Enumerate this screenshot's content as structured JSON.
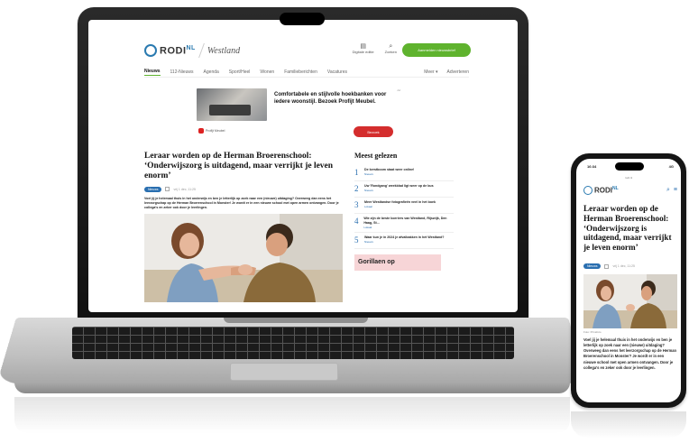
{
  "site": {
    "logo_text": "RODI",
    "logo_suffix": "NL",
    "region": "Westland",
    "tools": [
      {
        "icon": "newspaper-icon",
        "label": "Digitale editie"
      },
      {
        "icon": "search-icon",
        "label": "Zoeken"
      }
    ],
    "cta_label": "Aanmelden nieuwsbrief"
  },
  "nav": {
    "items": [
      "Nieuws",
      "112-Nieuws",
      "Agenda",
      "Sport/Heel",
      "Wonen",
      "Familieberichten",
      "Vacatures"
    ],
    "right_items": [
      "Meer ▾",
      "Adverteren"
    ],
    "active_index": 0
  },
  "ad": {
    "text": "Comfortabele en stijlvolle hoekbanken voor iedere woonstijl. Bezoek Profijt Meubel.",
    "brand": "Profijt Meubel",
    "cta": "Bezoek",
    "mark": "Ad"
  },
  "article": {
    "title": "Leraar worden op de Herman Broerenschool: ‘Onderwijszorg is uitdagend, maar verrijkt je leven enorm’",
    "badge": "Nieuws",
    "meta": "vrij 1 dec, 11:25",
    "lead": "Voel jij je helemaal thuis in het onderwijs en ben je letterlijk op zoek naar een (nieuwe) uitdaging? Overweeg dan eens het leerzorgschap op de Herman Broerenschool in Monster! Je wordt er in een nieuwe school met open armen ontvangen. Door je collega's en zeker ook door je leerlingen."
  },
  "sidebar": {
    "title": "Meest gelezen",
    "items": [
      {
        "num": "1",
        "text": "De kerstboom staat weer online!",
        "tag": "Nieuws"
      },
      {
        "num": "2",
        "text": "Uw 'Rondgang' weekblad ligt weer op de bus",
        "tag": "Nieuws"
      },
      {
        "num": "3",
        "text": "Meer Westlandse fotografieën veel in het boek",
        "tag": "Lokaal"
      },
      {
        "num": "4",
        "text": "Wie zijn de beste koeriers van Westland, Rijswijk, Den Haag, St...",
        "tag": "Lokaal"
      },
      {
        "num": "5",
        "text": "Waar kun je in 2024 je afvalbakken in het Westland?",
        "tag": "Nieuws"
      }
    ],
    "ad_text": "Gorillaen op"
  },
  "phone": {
    "time": "16:34",
    "signal": "4G",
    "url": "rodi.nl",
    "title": "Leraar worden op de Herman Broerenschool: ‘Onderwijszorg is uitdagend, maar verrijkt je leven enorm’",
    "badge": "Nieuws",
    "meta": "vrij 1 dec, 11:25",
    "caption": "Foto: Privéfoto",
    "lead": "Voel jij je helemaal thuis in het onderwijs en ben je letterlijk op zoek naar een (nieuwe) uitdaging? Overweeg dan eens het leerzorgschap op de Herman Broerenschool in Monster? Je wordt er in een nieuwe school met open armen ontvangen. Door je collega's en zeker ook door je leerlingen."
  },
  "colors": {
    "accent_green": "#5fb32e",
    "accent_blue": "#2a6fb0",
    "ad_red": "#d42d2d"
  }
}
